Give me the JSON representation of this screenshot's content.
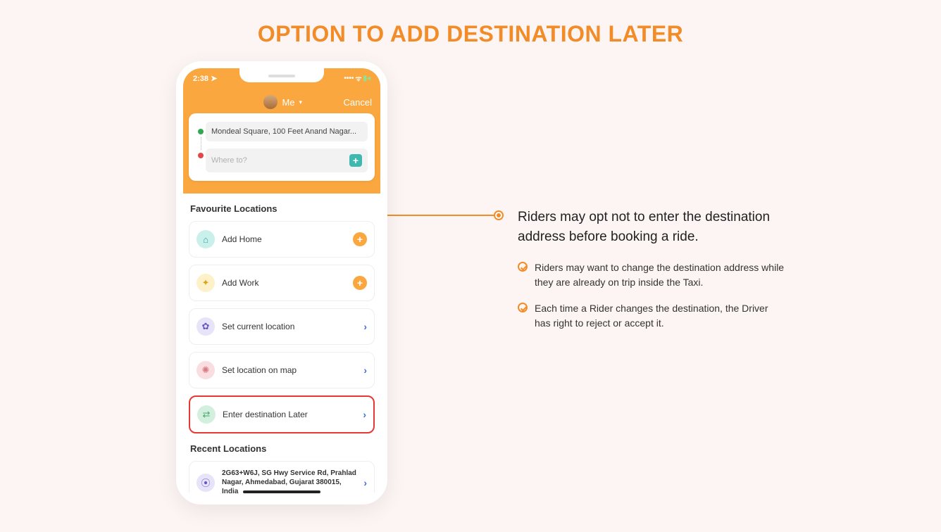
{
  "page": {
    "title": "OPTION TO ADD DESTINATION LATER"
  },
  "phone": {
    "time": "2:38",
    "header": {
      "user_label": "Me",
      "cancel": "Cancel"
    },
    "pickup_value": "Mondeal Square, 100 Feet Anand Nagar...",
    "destination_placeholder": "Where to?",
    "sections": {
      "favourites_heading": "Favourite Locations",
      "recent_heading": "Recent Locations"
    },
    "fav": {
      "add_home": "Add Home",
      "add_work": "Add Work",
      "set_current": "Set current location",
      "set_on_map": "Set location on map",
      "enter_later": "Enter destination Later"
    },
    "recent": {
      "addr1": "2G63+W6J, SG Hwy Service Rd, Prahlad Nagar, Ahmedabad, Gujarat 380015, India"
    }
  },
  "explain": {
    "main": "Riders may opt not to enter the destination address before booking a ride.",
    "bullets": [
      "Riders may want to change the destination address while they are already on trip inside the Taxi.",
      "Each time a Rider changes the destination, the Driver has right to reject or accept it."
    ]
  }
}
